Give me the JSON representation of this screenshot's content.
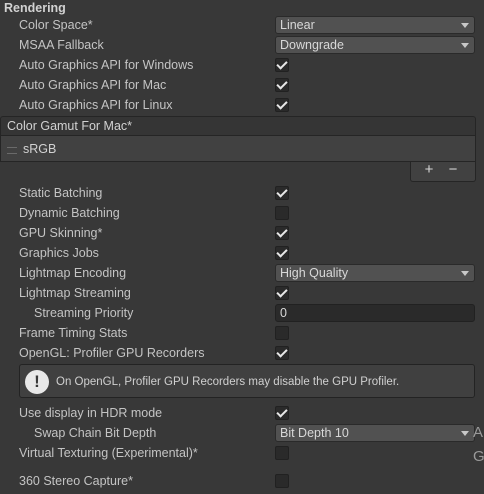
{
  "section": {
    "title": "Rendering"
  },
  "rows_top": [
    {
      "label": "Color Space*",
      "type": "dropdown",
      "value": "Linear"
    },
    {
      "label": "MSAA Fallback",
      "type": "dropdown",
      "value": "Downgrade"
    },
    {
      "label": "Auto Graphics API  for Windows",
      "type": "checkbox",
      "checked": true
    },
    {
      "label": "Auto Graphics API  for Mac",
      "type": "checkbox",
      "checked": true
    },
    {
      "label": "Auto Graphics API  for Linux",
      "type": "checkbox",
      "checked": true
    }
  ],
  "gamut_list": {
    "header": "Color Gamut For Mac*",
    "items": [
      "sRGB"
    ],
    "add_label": "+",
    "remove_label": "−"
  },
  "rows_bottom": {
    "static_batching": {
      "label": "Static Batching",
      "checked": true
    },
    "dynamic_batching": {
      "label": "Dynamic Batching",
      "checked": false
    },
    "gpu_skinning": {
      "label": "GPU Skinning*",
      "checked": true
    },
    "graphics_jobs": {
      "label": "Graphics Jobs",
      "checked": true
    },
    "lightmap_encoding": {
      "label": "Lightmap Encoding",
      "value": "High Quality"
    },
    "lightmap_streaming": {
      "label": "Lightmap Streaming",
      "checked": true
    },
    "streaming_priority": {
      "label": "Streaming Priority",
      "value": "0"
    },
    "frame_timing": {
      "label": "Frame Timing Stats",
      "checked": false
    },
    "opengl_profiler": {
      "label": "OpenGL: Profiler GPU Recorders",
      "checked": true
    },
    "helpbox": {
      "icon_text": "!",
      "message": "On OpenGL, Profiler GPU Recorders may disable the GPU Profiler."
    },
    "hdr_mode": {
      "label": "Use display in HDR mode",
      "checked": true
    },
    "swap_chain": {
      "label": "Swap Chain Bit Depth",
      "value": "Bit Depth 10"
    },
    "virtual_texturing": {
      "label": "Virtual Texturing (Experimental)*",
      "checked": false
    },
    "stereo_capture": {
      "label": "360 Stereo Capture*",
      "checked": false
    }
  },
  "edge": {
    "a": "A",
    "g": "G"
  }
}
